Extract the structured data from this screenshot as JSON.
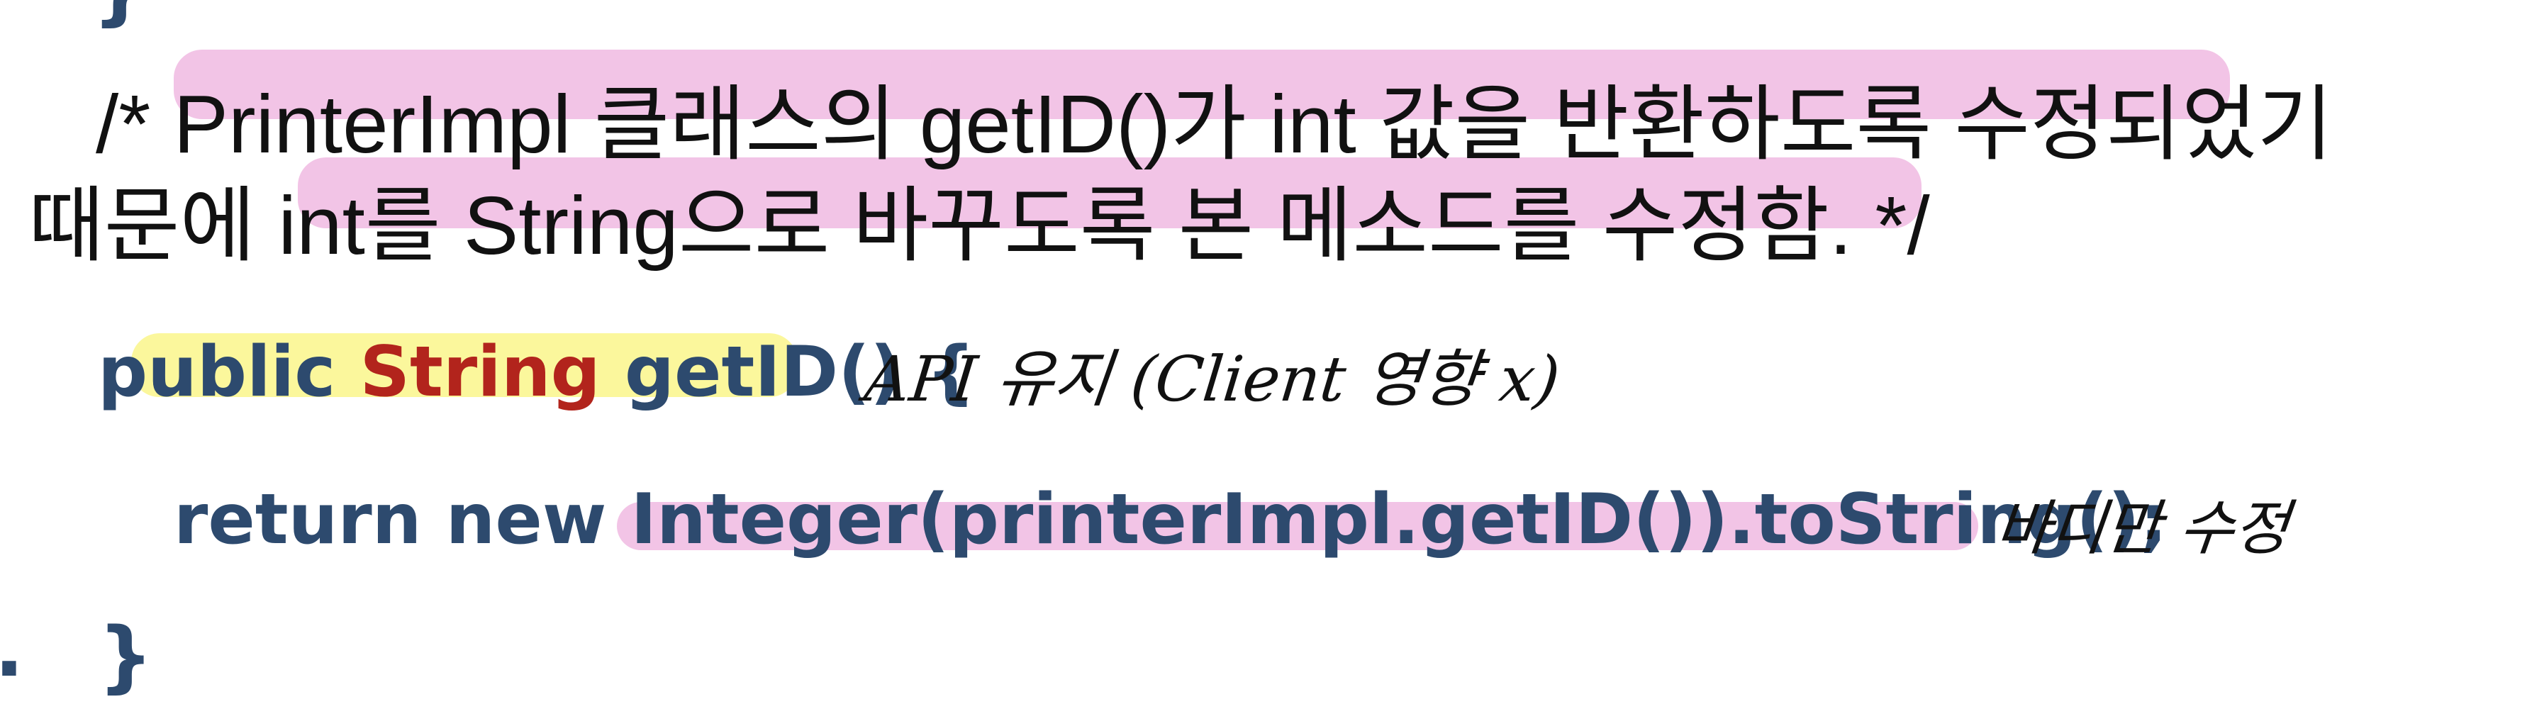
{
  "top_fragment": "}",
  "comment": {
    "line1": "/* PrinterImpl 클래스의 getID()가 int 값을 반환하도록 수정되었기",
    "line2": "때문에 int를 String으로 바꾸도록  본 메소드를 수정함. */"
  },
  "code": {
    "method_modifier": "public",
    "method_return_type": "String",
    "method_name": "getID()",
    "open_brace": "{",
    "return_stmt": "return new Integer(printerImpl.getID()).toString();",
    "close_brace": "}",
    "left_marker": "."
  },
  "annotations": {
    "signature_note": "API 유지 (Client 영향 x)",
    "body_note": "바디만 수정"
  },
  "colors": {
    "highlight_pink": "#f2c4e6",
    "highlight_yellow": "#fbf79c",
    "code_blue": "#2d4a6e",
    "code_red": "#b2241c"
  }
}
